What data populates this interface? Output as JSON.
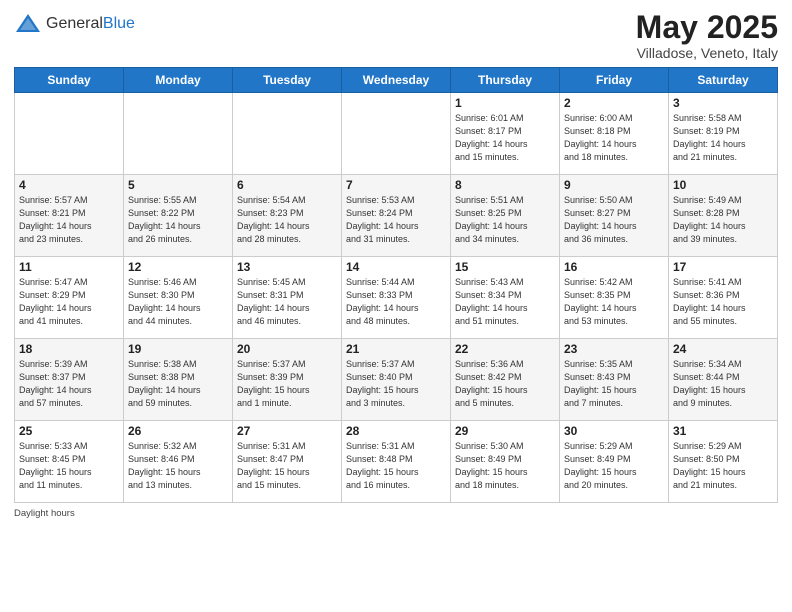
{
  "header": {
    "logo_general": "General",
    "logo_blue": "Blue",
    "title": "May 2025",
    "location": "Villadose, Veneto, Italy"
  },
  "days_of_week": [
    "Sunday",
    "Monday",
    "Tuesday",
    "Wednesday",
    "Thursday",
    "Friday",
    "Saturday"
  ],
  "weeks": [
    [
      {
        "day": "",
        "info": ""
      },
      {
        "day": "",
        "info": ""
      },
      {
        "day": "",
        "info": ""
      },
      {
        "day": "",
        "info": ""
      },
      {
        "day": "1",
        "info": "Sunrise: 6:01 AM\nSunset: 8:17 PM\nDaylight: 14 hours\nand 15 minutes."
      },
      {
        "day": "2",
        "info": "Sunrise: 6:00 AM\nSunset: 8:18 PM\nDaylight: 14 hours\nand 18 minutes."
      },
      {
        "day": "3",
        "info": "Sunrise: 5:58 AM\nSunset: 8:19 PM\nDaylight: 14 hours\nand 21 minutes."
      }
    ],
    [
      {
        "day": "4",
        "info": "Sunrise: 5:57 AM\nSunset: 8:21 PM\nDaylight: 14 hours\nand 23 minutes."
      },
      {
        "day": "5",
        "info": "Sunrise: 5:55 AM\nSunset: 8:22 PM\nDaylight: 14 hours\nand 26 minutes."
      },
      {
        "day": "6",
        "info": "Sunrise: 5:54 AM\nSunset: 8:23 PM\nDaylight: 14 hours\nand 28 minutes."
      },
      {
        "day": "7",
        "info": "Sunrise: 5:53 AM\nSunset: 8:24 PM\nDaylight: 14 hours\nand 31 minutes."
      },
      {
        "day": "8",
        "info": "Sunrise: 5:51 AM\nSunset: 8:25 PM\nDaylight: 14 hours\nand 34 minutes."
      },
      {
        "day": "9",
        "info": "Sunrise: 5:50 AM\nSunset: 8:27 PM\nDaylight: 14 hours\nand 36 minutes."
      },
      {
        "day": "10",
        "info": "Sunrise: 5:49 AM\nSunset: 8:28 PM\nDaylight: 14 hours\nand 39 minutes."
      }
    ],
    [
      {
        "day": "11",
        "info": "Sunrise: 5:47 AM\nSunset: 8:29 PM\nDaylight: 14 hours\nand 41 minutes."
      },
      {
        "day": "12",
        "info": "Sunrise: 5:46 AM\nSunset: 8:30 PM\nDaylight: 14 hours\nand 44 minutes."
      },
      {
        "day": "13",
        "info": "Sunrise: 5:45 AM\nSunset: 8:31 PM\nDaylight: 14 hours\nand 46 minutes."
      },
      {
        "day": "14",
        "info": "Sunrise: 5:44 AM\nSunset: 8:33 PM\nDaylight: 14 hours\nand 48 minutes."
      },
      {
        "day": "15",
        "info": "Sunrise: 5:43 AM\nSunset: 8:34 PM\nDaylight: 14 hours\nand 51 minutes."
      },
      {
        "day": "16",
        "info": "Sunrise: 5:42 AM\nSunset: 8:35 PM\nDaylight: 14 hours\nand 53 minutes."
      },
      {
        "day": "17",
        "info": "Sunrise: 5:41 AM\nSunset: 8:36 PM\nDaylight: 14 hours\nand 55 minutes."
      }
    ],
    [
      {
        "day": "18",
        "info": "Sunrise: 5:39 AM\nSunset: 8:37 PM\nDaylight: 14 hours\nand 57 minutes."
      },
      {
        "day": "19",
        "info": "Sunrise: 5:38 AM\nSunset: 8:38 PM\nDaylight: 14 hours\nand 59 minutes."
      },
      {
        "day": "20",
        "info": "Sunrise: 5:37 AM\nSunset: 8:39 PM\nDaylight: 15 hours\nand 1 minute."
      },
      {
        "day": "21",
        "info": "Sunrise: 5:37 AM\nSunset: 8:40 PM\nDaylight: 15 hours\nand 3 minutes."
      },
      {
        "day": "22",
        "info": "Sunrise: 5:36 AM\nSunset: 8:42 PM\nDaylight: 15 hours\nand 5 minutes."
      },
      {
        "day": "23",
        "info": "Sunrise: 5:35 AM\nSunset: 8:43 PM\nDaylight: 15 hours\nand 7 minutes."
      },
      {
        "day": "24",
        "info": "Sunrise: 5:34 AM\nSunset: 8:44 PM\nDaylight: 15 hours\nand 9 minutes."
      }
    ],
    [
      {
        "day": "25",
        "info": "Sunrise: 5:33 AM\nSunset: 8:45 PM\nDaylight: 15 hours\nand 11 minutes."
      },
      {
        "day": "26",
        "info": "Sunrise: 5:32 AM\nSunset: 8:46 PM\nDaylight: 15 hours\nand 13 minutes."
      },
      {
        "day": "27",
        "info": "Sunrise: 5:31 AM\nSunset: 8:47 PM\nDaylight: 15 hours\nand 15 minutes."
      },
      {
        "day": "28",
        "info": "Sunrise: 5:31 AM\nSunset: 8:48 PM\nDaylight: 15 hours\nand 16 minutes."
      },
      {
        "day": "29",
        "info": "Sunrise: 5:30 AM\nSunset: 8:49 PM\nDaylight: 15 hours\nand 18 minutes."
      },
      {
        "day": "30",
        "info": "Sunrise: 5:29 AM\nSunset: 8:49 PM\nDaylight: 15 hours\nand 20 minutes."
      },
      {
        "day": "31",
        "info": "Sunrise: 5:29 AM\nSunset: 8:50 PM\nDaylight: 15 hours\nand 21 minutes."
      }
    ]
  ],
  "footer": {
    "daylight_label": "Daylight hours"
  }
}
